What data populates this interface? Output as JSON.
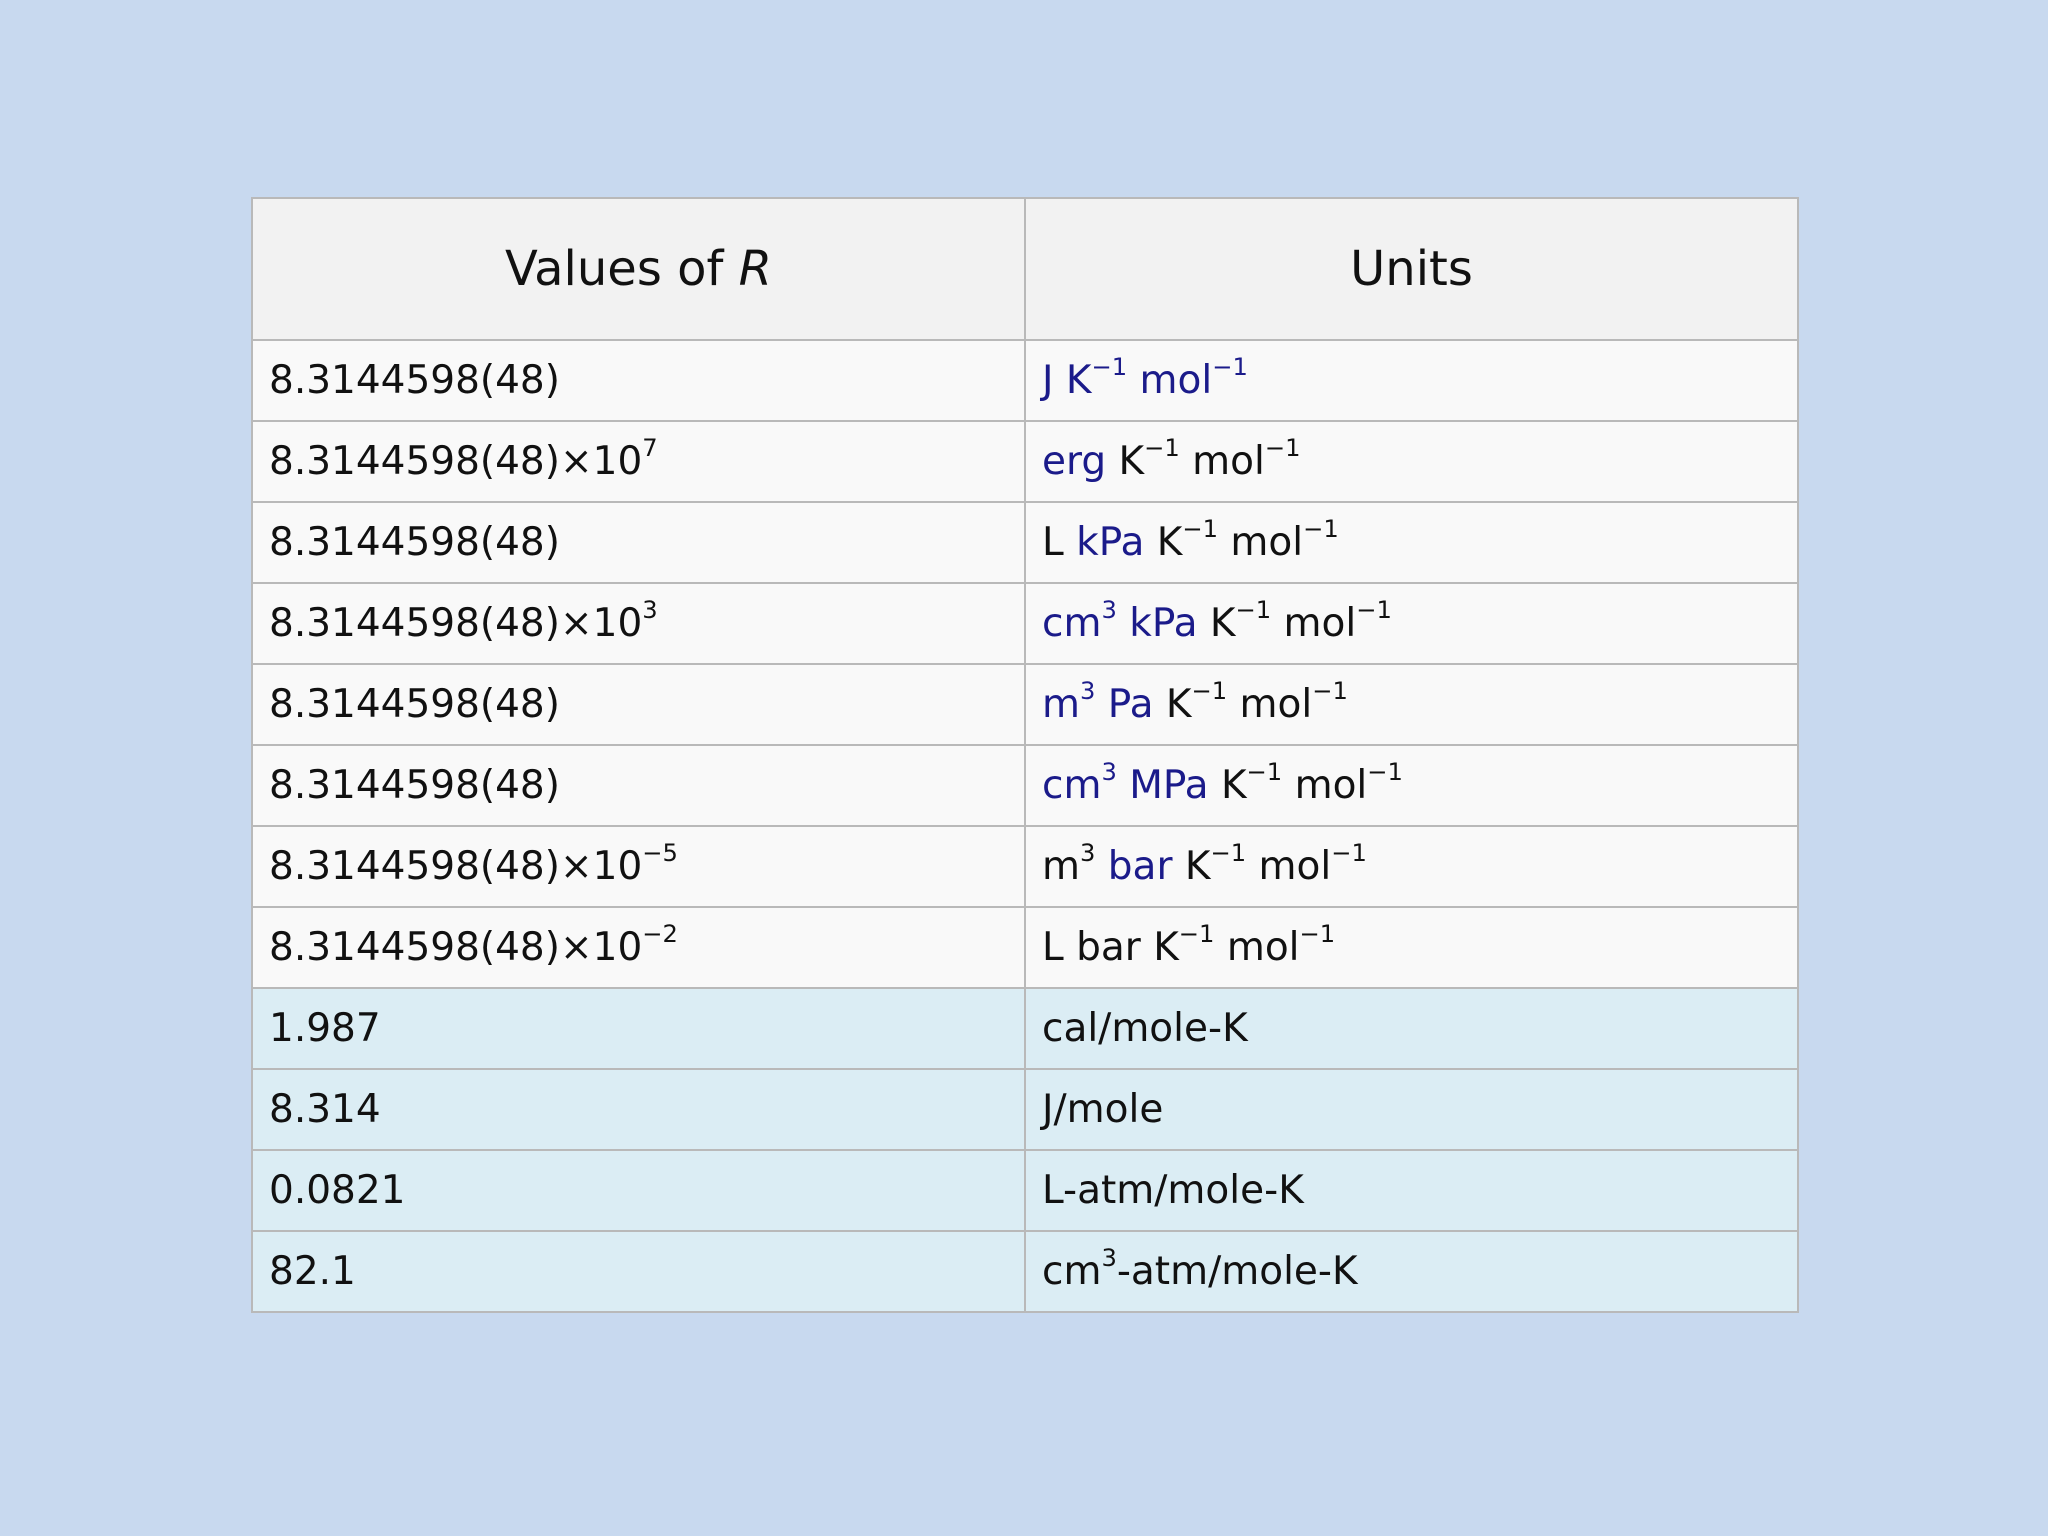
{
  "table": {
    "header": {
      "values_prefix": "Values of ",
      "values_symbol": "R",
      "units": "Units"
    },
    "colors": {
      "header_bg": "#f2f2f2",
      "white_row_bg": "#f9f9f9",
      "blue_row_bg": "#dbedf4",
      "link_text": "#1b1b8a",
      "background": "#c8d9ef"
    },
    "rows": [
      {
        "style": "white",
        "value": "8.3144598(48)",
        "exponent": "",
        "units": [
          {
            "text": "J",
            "link": true
          },
          {
            "text": " ",
            "link": false
          },
          {
            "text": "K",
            "sup": "−1",
            "link": true
          },
          {
            "text": " ",
            "link": false
          },
          {
            "text": "mol",
            "sup": "−1",
            "link": true
          }
        ]
      },
      {
        "style": "white",
        "value": "8.3144598(48)×10",
        "exponent": "7",
        "units": [
          {
            "text": "erg",
            "link": true
          },
          {
            "text": " K",
            "sup": "−1",
            "link": false
          },
          {
            "text": " mol",
            "sup": "−1",
            "link": false
          }
        ]
      },
      {
        "style": "white",
        "value": "8.3144598(48)",
        "exponent": "",
        "units": [
          {
            "text": "L ",
            "link": false
          },
          {
            "text": "kPa",
            "link": true
          },
          {
            "text": " K",
            "sup": "−1",
            "link": false
          },
          {
            "text": " mol",
            "sup": "−1",
            "link": false
          }
        ]
      },
      {
        "style": "white",
        "value": "8.3144598(48)×10",
        "exponent": "3",
        "units": [
          {
            "text": "cm",
            "sup": "3",
            "link": true
          },
          {
            "text": " ",
            "link": false
          },
          {
            "text": "kPa",
            "link": true
          },
          {
            "text": " K",
            "sup": "−1",
            "link": false
          },
          {
            "text": " mol",
            "sup": "−1",
            "link": false
          }
        ]
      },
      {
        "style": "white",
        "value": "8.3144598(48)",
        "exponent": "",
        "units": [
          {
            "text": "m",
            "sup": "3",
            "link": true
          },
          {
            "text": " ",
            "link": false
          },
          {
            "text": "Pa",
            "link": true
          },
          {
            "text": " K",
            "sup": "−1",
            "link": false
          },
          {
            "text": " mol",
            "sup": "−1",
            "link": false
          }
        ]
      },
      {
        "style": "white",
        "value": "8.3144598(48)",
        "exponent": "",
        "units": [
          {
            "text": "cm",
            "sup": "3",
            "link": true
          },
          {
            "text": " ",
            "link": false
          },
          {
            "text": "MPa",
            "link": true
          },
          {
            "text": " K",
            "sup": "−1",
            "link": false
          },
          {
            "text": " mol",
            "sup": "−1",
            "link": false
          }
        ]
      },
      {
        "style": "white",
        "value": "8.3144598(48)×10",
        "exponent": "−5",
        "units": [
          {
            "text": "m",
            "sup": "3",
            "link": false
          },
          {
            "text": " ",
            "link": false
          },
          {
            "text": "bar",
            "link": true
          },
          {
            "text": " K",
            "sup": "−1",
            "link": false
          },
          {
            "text": " mol",
            "sup": "−1",
            "link": false
          }
        ]
      },
      {
        "style": "white",
        "value": "8.3144598(48)×10",
        "exponent": "−2",
        "units": [
          {
            "text": "L bar K",
            "sup": "−1",
            "link": false
          },
          {
            "text": " mol",
            "sup": "−1",
            "link": false
          }
        ]
      },
      {
        "style": "blue",
        "value": "1.987",
        "exponent": "",
        "units": [
          {
            "text": "cal/mole-K",
            "link": false
          }
        ]
      },
      {
        "style": "blue",
        "value": "8.314",
        "exponent": "",
        "units": [
          {
            "text": "J/mole",
            "link": false
          }
        ]
      },
      {
        "style": "blue",
        "value": "0.0821",
        "exponent": "",
        "units": [
          {
            "text": "L-atm/mole-K",
            "link": false
          }
        ]
      },
      {
        "style": "blue",
        "value": "82.1",
        "exponent": "",
        "units": [
          {
            "text": "cm",
            "sup": "3",
            "link": false
          },
          {
            "text": "-atm/mole-K",
            "link": false
          }
        ]
      }
    ]
  }
}
